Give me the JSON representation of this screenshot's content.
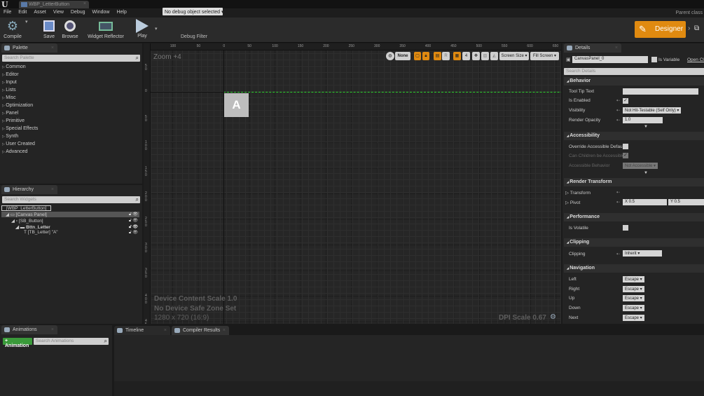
{
  "window": {
    "tab_title": "WBP_LetterButton",
    "parent_class": "Parent class"
  },
  "menu": [
    "File",
    "Edit",
    "Asset",
    "View",
    "Debug",
    "Window",
    "Help"
  ],
  "toolbar": {
    "compile": "Compile",
    "save": "Save",
    "browse": "Browse",
    "widget_reflector": "Widget Reflector",
    "play": "Play",
    "debug_object": "No debug object selected",
    "debug_filter": "Debug Filter",
    "designer": "Designer"
  },
  "palette": {
    "title": "Palette",
    "search_placeholder": "Search Palette",
    "items": [
      "Common",
      "Editor",
      "Input",
      "Lists",
      "Misc",
      "Optimization",
      "Panel",
      "Primitive",
      "Special Effects",
      "Synth",
      "User Created",
      "Advanced"
    ]
  },
  "hierarchy": {
    "title": "Hierarchy",
    "search_placeholder": "Search Widgets",
    "rows": [
      "[WBP_LetterButton]",
      "[Canvas Panel]",
      "[SB_Button]",
      "Bttn_Letter",
      "[TB_Letter] \"A\""
    ]
  },
  "canvas": {
    "zoom": "Zoom +4",
    "ruler_top": [
      "100",
      "50",
      "0",
      "50",
      "100",
      "150",
      "200",
      "250",
      "300",
      "350",
      "400",
      "450",
      "500",
      "550",
      "600",
      "650"
    ],
    "ruler_left": [
      "50",
      "0",
      "50",
      "100",
      "150",
      "200",
      "250",
      "300",
      "350",
      "400",
      "450"
    ],
    "letter": "A",
    "device_scale": "Device Content Scale 1.0",
    "safe_zone": "No Device Safe Zone Set",
    "resolution": "1280 x 720 (16:9)",
    "dpi_scale": "DPI Scale 0.67",
    "toolbar": {
      "none": "None",
      "r": "R",
      "grid_snap": "4",
      "screen_size": "Screen Size",
      "fill_screen": "Fill Screen"
    }
  },
  "details": {
    "title": "Details",
    "name": "CanvasPanel_0",
    "is_variable": "Is Variable",
    "open_class": "Open Class",
    "search_placeholder": "Search Details",
    "behavior": {
      "title": "Behavior",
      "tooltip": "Tool Tip Text",
      "is_enabled": "Is Enabled",
      "visibility": "Visibility",
      "visibility_value": "Not Hit-Testable (Self Only)",
      "render_opacity": "Render Opacity",
      "render_opacity_value": "1.0"
    },
    "accessibility": {
      "title": "Accessibility",
      "override": "Override Accessible Defaul",
      "children": "Can Children be Accessible",
      "behavior": "Accessible Behavior",
      "behavior_value": "Not Accessible"
    },
    "render_transform": {
      "title": "Render Transform",
      "transform": "Transform",
      "pivot": "Pivot",
      "pivot_x": "X  0.5",
      "pivot_y": "Y  0.5"
    },
    "performance": {
      "title": "Performance",
      "is_volatile": "Is Volatile"
    },
    "clipping": {
      "title": "Clipping",
      "clipping": "Clipping",
      "clipping_value": "Inherit"
    },
    "navigation": {
      "title": "Navigation",
      "rows": [
        {
          "label": "Left",
          "value": "Escape"
        },
        {
          "label": "Right",
          "value": "Escape"
        },
        {
          "label": "Up",
          "value": "Escape"
        },
        {
          "label": "Down",
          "value": "Escape"
        },
        {
          "label": "Next",
          "value": "Escape"
        }
      ]
    }
  },
  "animations": {
    "title": "Animations",
    "add": "+ Animation",
    "search_placeholder": "Search Animations"
  },
  "bottom_tabs": {
    "timeline": "Timeline",
    "compiler": "Compiler Results"
  }
}
